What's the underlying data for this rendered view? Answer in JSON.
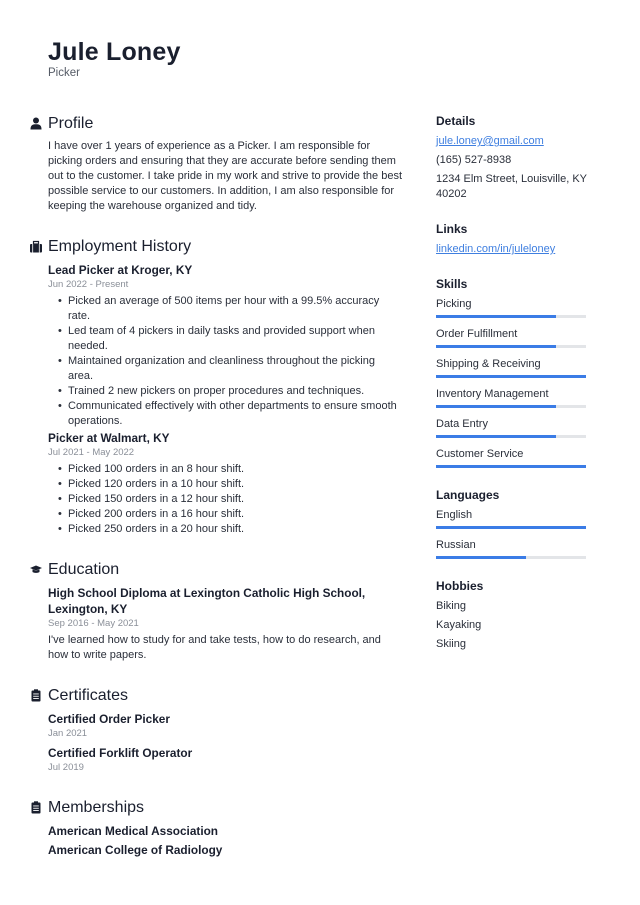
{
  "header": {
    "name": "Jule Loney",
    "title": "Picker"
  },
  "profile": {
    "heading": "Profile",
    "icon": "user-icon",
    "text": "I have over 1 years of experience as a Picker. I am responsible for picking orders and ensuring that they are accurate before sending them out to the customer. I take pride in my work and strive to provide the best possible service to our customers. In addition, I am also responsible for keeping the warehouse organized and tidy."
  },
  "employment": {
    "heading": "Employment History",
    "icon": "briefcase-icon",
    "jobs": [
      {
        "title": "Lead Picker at Kroger, KY",
        "dates": "Jun 2022 - Present",
        "bullets": [
          "Picked an average of 500 items per hour with a 99.5% accuracy rate.",
          "Led team of 4 pickers in daily tasks and provided support when needed.",
          "Maintained organization and cleanliness throughout the picking area.",
          "Trained 2 new pickers on proper procedures and techniques.",
          "Communicated effectively with other departments to ensure smooth operations."
        ]
      },
      {
        "title": "Picker at Walmart, KY",
        "dates": "Jul 2021 - May 2022",
        "bullets": [
          "Picked 100 orders in an 8 hour shift.",
          "Picked 120 orders in a 10 hour shift.",
          "Picked 150 orders in a 12 hour shift.",
          "Picked 200 orders in a 16 hour shift.",
          "Picked 250 orders in a 20 hour shift."
        ]
      }
    ]
  },
  "education": {
    "heading": "Education",
    "icon": "graduation-cap-icon",
    "items": [
      {
        "title": "High School Diploma at Lexington Catholic High School, Lexington, KY",
        "dates": "Sep 2016 - May 2021",
        "description": "I've learned how to study for and take tests, how to do research, and how to write papers."
      }
    ]
  },
  "certificates": {
    "heading": "Certificates",
    "icon": "clipboard-icon",
    "items": [
      {
        "title": "Certified Order Picker",
        "date": "Jan 2021"
      },
      {
        "title": "Certified Forklift Operator",
        "date": "Jul 2019"
      }
    ]
  },
  "memberships": {
    "heading": "Memberships",
    "icon": "clipboard-icon",
    "items": [
      "American Medical Association",
      "American College of Radiology"
    ]
  },
  "details": {
    "heading": "Details",
    "email": "jule.loney@gmail.com",
    "phone": "(165) 527-8938",
    "address": "1234 Elm Street, Louisville, KY 40202"
  },
  "links": {
    "heading": "Links",
    "items": [
      "linkedin.com/in/juleloney"
    ]
  },
  "skills": {
    "heading": "Skills",
    "items": [
      {
        "label": "Picking",
        "level": 0.8
      },
      {
        "label": "Order Fulfillment",
        "level": 0.8
      },
      {
        "label": "Shipping & Receiving",
        "level": 1.0
      },
      {
        "label": "Inventory Management",
        "level": 0.8
      },
      {
        "label": "Data Entry",
        "level": 0.8
      },
      {
        "label": "Customer Service",
        "level": 1.0
      }
    ]
  },
  "languages": {
    "heading": "Languages",
    "items": [
      {
        "label": "English",
        "level": 1.0
      },
      {
        "label": "Russian",
        "level": 0.6
      }
    ]
  },
  "hobbies": {
    "heading": "Hobbies",
    "items": [
      "Biking",
      "Kayaking",
      "Skiing"
    ]
  },
  "colors": {
    "accent": "#3b7ce6",
    "link": "#3f7fe0",
    "track": "#e3e5e8",
    "text": "#1a1f2e"
  }
}
